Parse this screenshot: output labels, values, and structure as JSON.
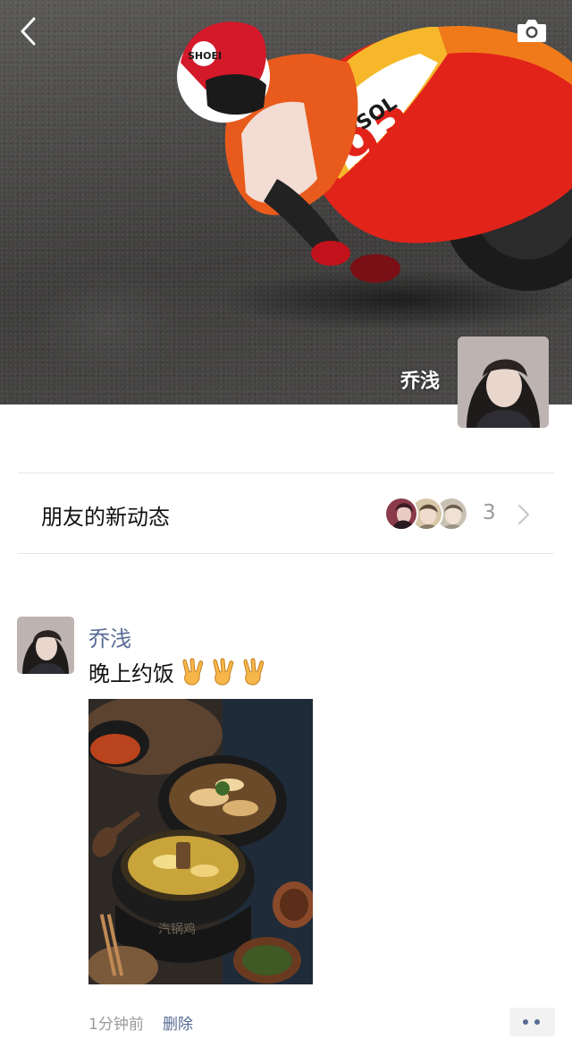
{
  "profile": {
    "name": "乔浅",
    "cover_image": "motorcycle-racer-cover",
    "avatar_image": "user-portrait"
  },
  "header": {
    "back_icon": "chevron-left-icon",
    "camera_icon": "camera-icon"
  },
  "friends_updates": {
    "title": "朋友的新动态",
    "count": "3",
    "avatars": [
      "friend-avatar-1",
      "friend-avatar-2",
      "friend-avatar-3"
    ]
  },
  "post": {
    "author": "乔浅",
    "text": "晚上约饭",
    "emojis": [
      "victory-hand-emoji",
      "victory-hand-emoji",
      "victory-hand-emoji"
    ],
    "photo": "food-photo",
    "time": "1分钟前",
    "delete_label": "删除",
    "more_icon": "more-dots-icon"
  },
  "colors": {
    "link_blue": "#576b95",
    "muted_gray": "#9a9a9a",
    "divider": "#e6e6e6"
  }
}
